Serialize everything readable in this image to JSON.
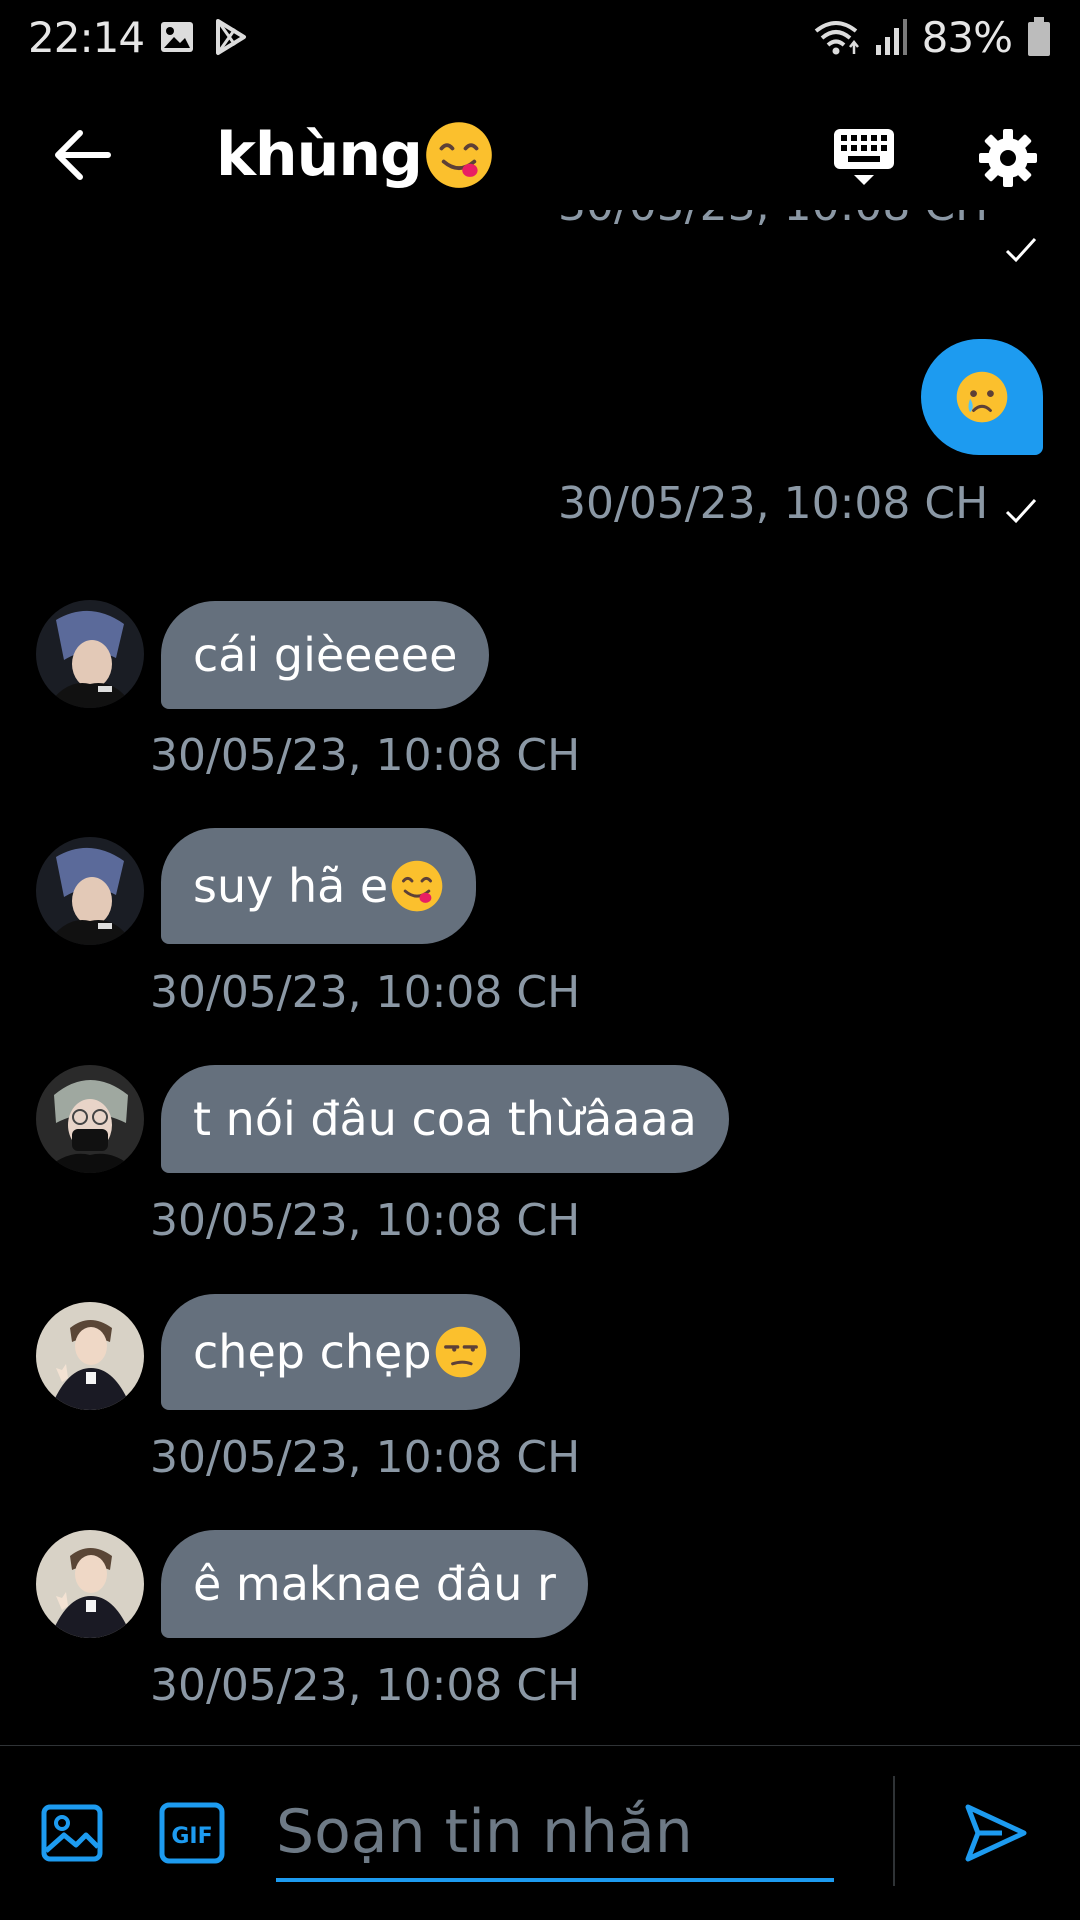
{
  "status_bar": {
    "time": "22:14",
    "battery_percent": "83%",
    "icons": [
      "gallery-notification-icon",
      "play-store-notification-icon",
      "wifi-icon",
      "signal-icon",
      "battery-icon"
    ]
  },
  "header": {
    "title": "khùng",
    "title_emoji": "yum-face-emoji",
    "icons": [
      "back-arrow-icon",
      "keyboard-icon",
      "gear-icon"
    ]
  },
  "messages": {
    "top_partial_timestamp": "30/05/23, 10:08 CH",
    "sent": {
      "emoji": "crying-face-emoji",
      "timestamp": "30/05/23, 10:08 CH"
    },
    "received": [
      {
        "text": "cái gièeeee",
        "emoji": "",
        "timestamp": "30/05/23, 10:08 CH",
        "avatar": "avatar-1"
      },
      {
        "text": "suy hã e",
        "emoji": "yum-face-emoji",
        "timestamp": "30/05/23, 10:08 CH",
        "avatar": "avatar-1"
      },
      {
        "text": "t nói đâu coa thừâaaa",
        "emoji": "",
        "timestamp": "30/05/23, 10:08 CH",
        "avatar": "avatar-2"
      },
      {
        "text": "chẹp chẹp",
        "emoji": "unamused-face-emoji",
        "timestamp": "30/05/23, 10:08 CH",
        "avatar": "avatar-3"
      },
      {
        "text": "ê maknae đâu r",
        "emoji": "",
        "timestamp": "30/05/23, 10:08 CH",
        "avatar": "avatar-3"
      }
    ]
  },
  "composer": {
    "placeholder": "Soạn tin nhắn",
    "value": "",
    "gif_label": "GIF",
    "icons": [
      "image-icon",
      "gif-icon",
      "send-icon"
    ]
  },
  "colors": {
    "background": "#000000",
    "accent": "#1d9bf0",
    "received_bubble": "#65707d",
    "timestamp": "#8b98a5"
  }
}
